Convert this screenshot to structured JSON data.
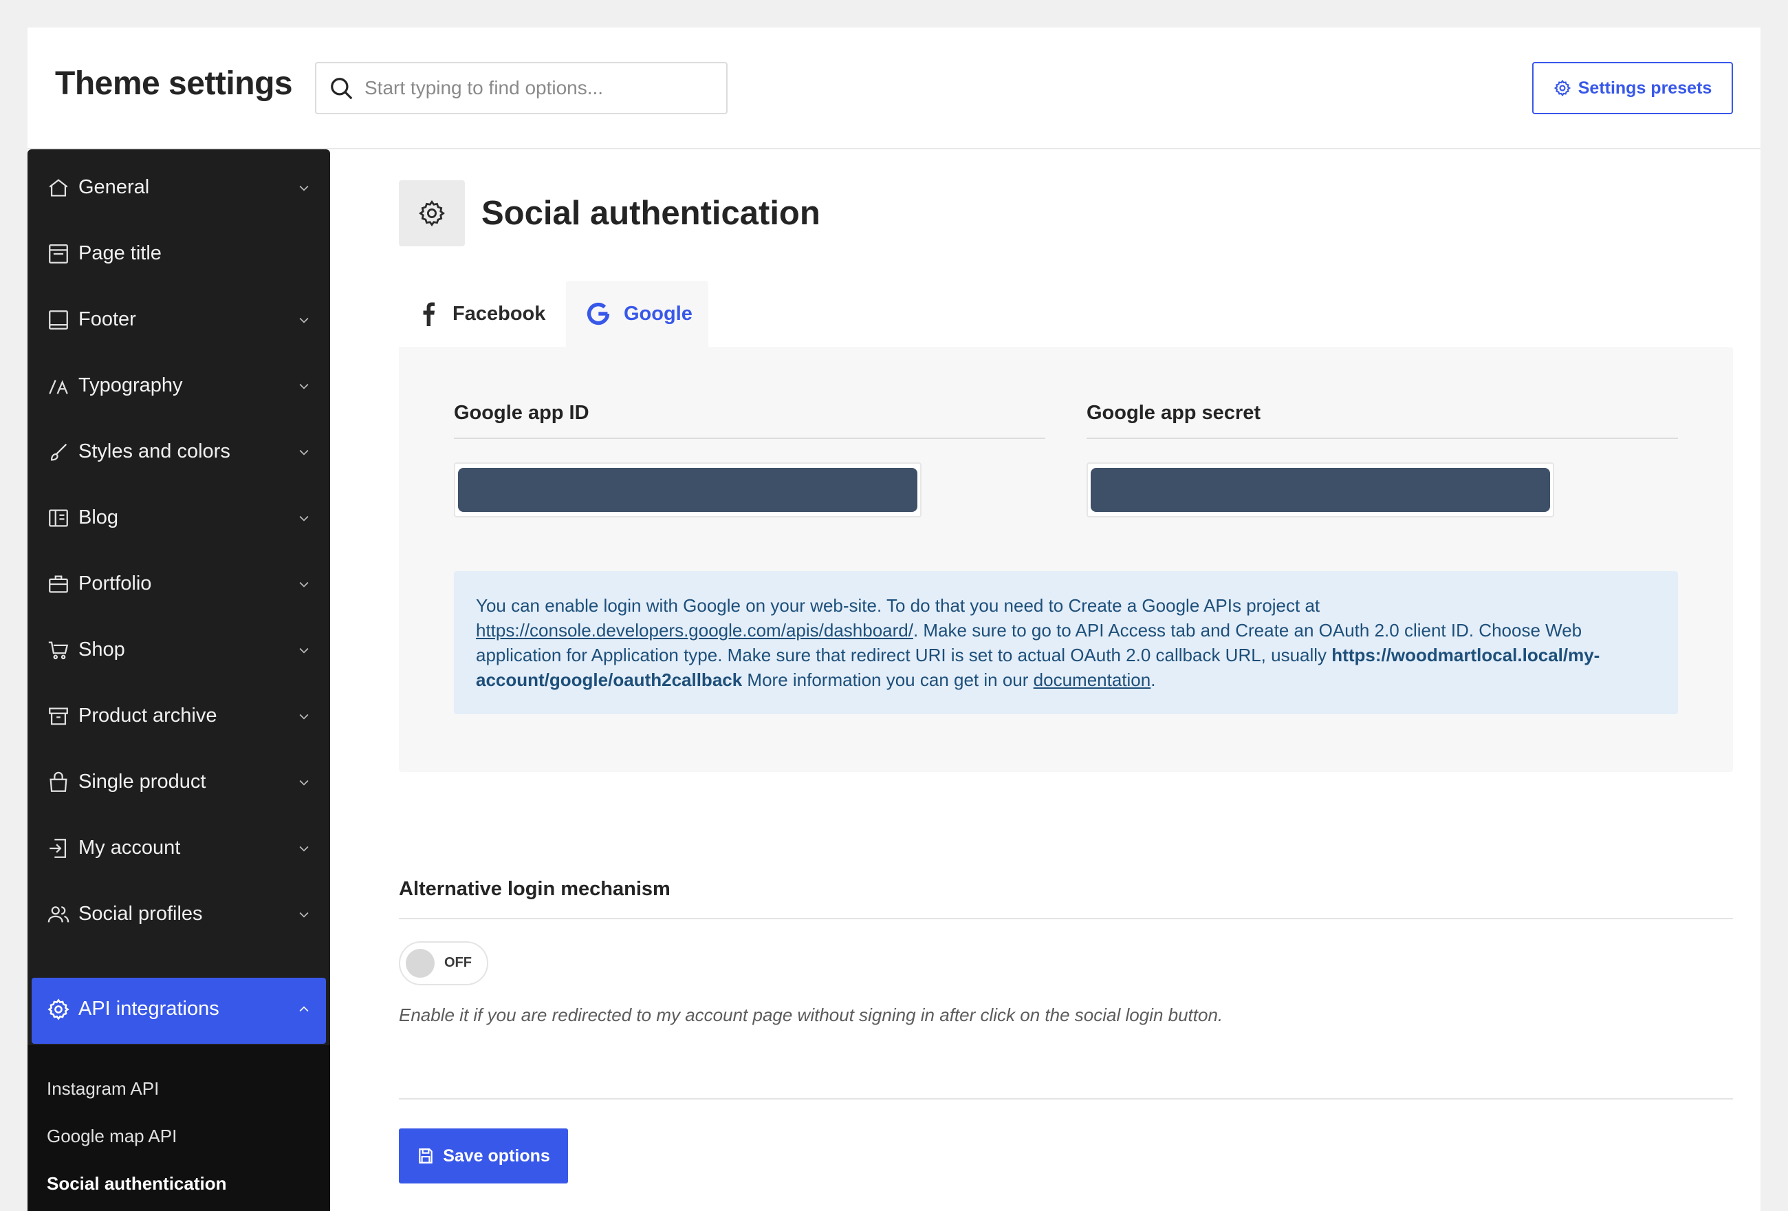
{
  "header": {
    "title": "Theme settings",
    "search_placeholder": "Start typing to find options...",
    "presets_label": "Settings presets"
  },
  "sidebar": {
    "items": [
      {
        "label": "General",
        "icon": "home-icon",
        "expandable": true
      },
      {
        "label": "Page title",
        "icon": "page-title-icon",
        "expandable": false
      },
      {
        "label": "Footer",
        "icon": "footer-icon",
        "expandable": true
      },
      {
        "label": "Typography",
        "icon": "typography-icon",
        "expandable": true
      },
      {
        "label": "Styles and colors",
        "icon": "brush-icon",
        "expandable": true
      },
      {
        "label": "Blog",
        "icon": "blog-icon",
        "expandable": true
      },
      {
        "label": "Portfolio",
        "icon": "briefcase-icon",
        "expandable": true
      },
      {
        "label": "Shop",
        "icon": "cart-icon",
        "expandable": true
      },
      {
        "label": "Product archive",
        "icon": "archive-icon",
        "expandable": true
      },
      {
        "label": "Single product",
        "icon": "bag-icon",
        "expandable": true
      },
      {
        "label": "My account",
        "icon": "login-icon",
        "expandable": true
      },
      {
        "label": "Social profiles",
        "icon": "users-icon",
        "expandable": true
      },
      {
        "label": "API integrations",
        "icon": "gear-icon",
        "expandable": true,
        "active": true
      }
    ],
    "subitems": [
      {
        "label": "Instagram API"
      },
      {
        "label": "Google map API"
      },
      {
        "label": "Social authentication",
        "current": true
      }
    ]
  },
  "section": {
    "title": "Social authentication",
    "icon": "gear-icon",
    "tabs": [
      {
        "label": "Facebook",
        "icon": "facebook-icon"
      },
      {
        "label": "Google",
        "icon": "google-icon",
        "active": true
      }
    ]
  },
  "google": {
    "app_id_label": "Google app ID",
    "app_id_value": "",
    "app_secret_label": "Google app secret",
    "app_secret_value": "",
    "notice": {
      "text1": "You can enable login with Google on your web-site. To do that you need to Create a Google APIs project at ",
      "link1": "https://console.developers.google.com/apis/dashboard/",
      "text2": ". Make sure to go to API Access tab and Create an OAuth 2.0 client ID. Choose Web application for Application type. Make sure that redirect URI is set to actual OAuth 2.0 callback URL, usually ",
      "callback": "https://woodmartlocal.local/my-account/google/oauth2callback",
      "text3": " More information you can get in our ",
      "link2": "documentation",
      "text4": "."
    }
  },
  "alternative_login": {
    "label": "Alternative login mechanism",
    "toggle_label": "OFF",
    "enabled": false,
    "description": "Enable it if you are redirected to my account page without signing in after click on the social login button."
  },
  "footer": {
    "save_label": "Save options"
  },
  "colors": {
    "accent": "#3858e9",
    "sidebar_bg": "#1e1e1e",
    "notice_bg": "#e4eef8",
    "notice_text": "#1d4f7a",
    "masked_input": "#3e5068"
  }
}
